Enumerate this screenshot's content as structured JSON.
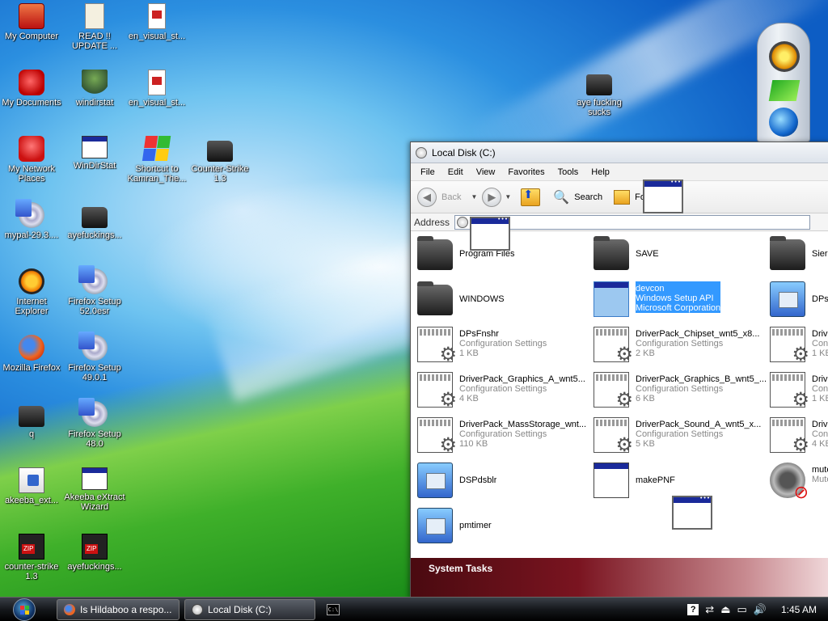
{
  "desktop": {
    "icons": [
      {
        "label": "My Computer",
        "icon": "computer-icon"
      },
      {
        "label": "READ !!\nUPDATE ...",
        "icon": "text-document-icon"
      },
      {
        "label": "en_visual_st...",
        "icon": "document-icon"
      },
      {
        "label": "My Documents",
        "icon": "documents-icon"
      },
      {
        "label": "windirstat",
        "icon": "tree-icon"
      },
      {
        "label": "en_visual_st...",
        "icon": "document-icon"
      },
      {
        "label": "My Network\nPlaces",
        "icon": "network-icon"
      },
      {
        "label": "WinDirStat",
        "icon": "application-icon"
      },
      {
        "label": "Shortcut to\nKamran_The...",
        "icon": "windows-logo-icon"
      },
      {
        "label": "Counter-Strike\n1.3",
        "icon": "folder-icon"
      },
      {
        "label": "mypal-29.3....",
        "icon": "setup-disc-icon"
      },
      {
        "label": "ayefuckings...",
        "icon": "folder-icon"
      },
      {
        "label": "Internet\nExplorer",
        "icon": "internet-explorer-icon"
      },
      {
        "label": "Firefox Setup\n52.0esr",
        "icon": "setup-disc-icon"
      },
      {
        "label": "Mozilla Firefox",
        "icon": "firefox-icon"
      },
      {
        "label": "Firefox Setup\n49.0.1",
        "icon": "setup-disc-icon"
      },
      {
        "label": "q",
        "icon": "folder-icon"
      },
      {
        "label": "Firefox Setup\n48.0",
        "icon": "setup-disc-icon"
      },
      {
        "label": "akeeba_ext...",
        "icon": "installer-icon"
      },
      {
        "label": "Akeeba eXtract\nWizard",
        "icon": "application-icon"
      },
      {
        "label": "counter-strike\n1.3",
        "icon": "zip-archive-icon"
      },
      {
        "label": "ayefuckings...",
        "icon": "zip-archive-icon"
      },
      {
        "label": "aye fucking\nsucks",
        "icon": "folder-icon"
      }
    ]
  },
  "explorer": {
    "title": "Local Disk (C:)",
    "menu": [
      "File",
      "Edit",
      "View",
      "Favorites",
      "Tools",
      "Help"
    ],
    "toolbar": {
      "back": "Back",
      "search": "Search",
      "folders": "Fo"
    },
    "address_label": "Address",
    "files": [
      {
        "name": "Program Files",
        "type": "",
        "size": "",
        "icon": "folder-icon"
      },
      {
        "name": "SAVE",
        "type": "",
        "size": "",
        "icon": "folder-icon"
      },
      {
        "name": "Sierr",
        "type": "",
        "size": "",
        "icon": "folder-icon"
      },
      {
        "name": "WINDOWS",
        "type": "",
        "size": "",
        "icon": "folder-icon"
      },
      {
        "name": "devcon",
        "type": "Windows Setup API",
        "size": "Microsoft Corporation",
        "icon": "application-icon",
        "selected": true
      },
      {
        "name": "DPsF",
        "type": "",
        "size": "",
        "icon": "setup-icon"
      },
      {
        "name": "DPsFnshr",
        "type": "Configuration Settings",
        "size": "1 KB",
        "icon": "config-icon"
      },
      {
        "name": "DriverPack_Chipset_wnt5_x8...",
        "type": "Configuration Settings",
        "size": "2 KB",
        "icon": "config-icon"
      },
      {
        "name": "Drive",
        "type": "Confi",
        "size": "1 KB",
        "icon": "config-icon"
      },
      {
        "name": "DriverPack_Graphics_A_wnt5...",
        "type": "Configuration Settings",
        "size": "4 KB",
        "icon": "config-icon"
      },
      {
        "name": "DriverPack_Graphics_B_wnt5_...",
        "type": "Configuration Settings",
        "size": "6 KB",
        "icon": "config-icon"
      },
      {
        "name": "Drive",
        "type": "Confi",
        "size": "1 KB",
        "icon": "config-icon"
      },
      {
        "name": "DriverPack_MassStorage_wnt...",
        "type": "Configuration Settings",
        "size": "110 KB",
        "icon": "config-icon"
      },
      {
        "name": "DriverPack_Sound_A_wnt5_x...",
        "type": "Configuration Settings",
        "size": "5 KB",
        "icon": "config-icon"
      },
      {
        "name": "Drive",
        "type": "Confi",
        "size": "4 KB",
        "icon": "config-icon"
      },
      {
        "name": "DSPdsblr",
        "type": "",
        "size": "",
        "icon": "setup-icon"
      },
      {
        "name": "makePNF",
        "type": "",
        "size": "",
        "icon": "application-icon"
      },
      {
        "name": "mute",
        "type": "Mute",
        "size": "",
        "icon": "mute-icon"
      },
      {
        "name": "pmtimer",
        "type": "",
        "size": "",
        "icon": "setup-icon"
      }
    ],
    "tasks_title": "System Tasks"
  },
  "taskbar": {
    "buttons": [
      {
        "label": "Is Hildaboo a respo...",
        "icon": "firefox-icon"
      },
      {
        "label": "Local Disk (C:)",
        "icon": "disk-icon"
      }
    ],
    "quicklaunch_label": "C:\\",
    "clock": "1:45 AM",
    "tray_help": "?"
  }
}
